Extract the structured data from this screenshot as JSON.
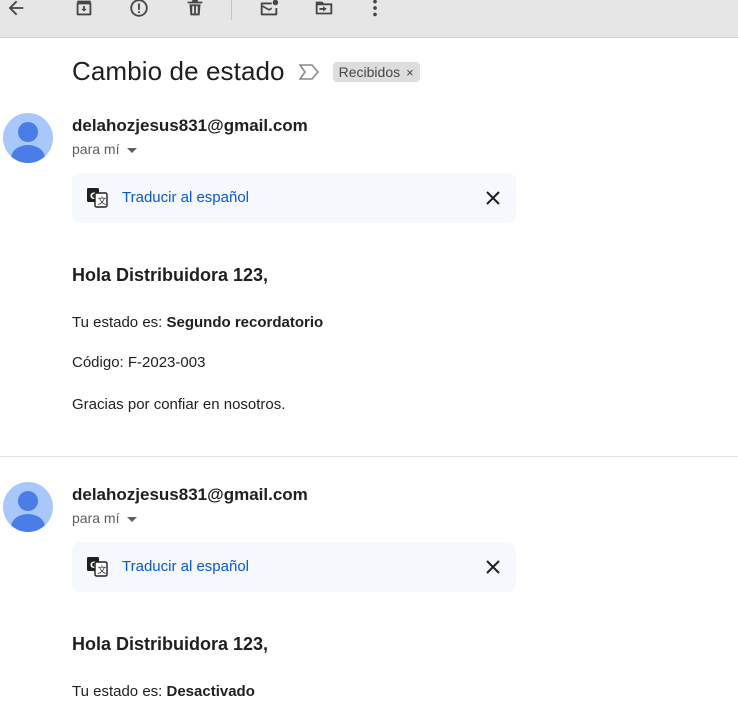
{
  "toolbar": {
    "buttons": [
      {
        "name": "back-arrow-icon"
      },
      {
        "name": "archive-icon"
      },
      {
        "name": "report-spam-icon"
      },
      {
        "name": "delete-icon"
      },
      {
        "name": "mark-unread-icon"
      },
      {
        "name": "move-to-icon"
      },
      {
        "name": "more-vert-icon"
      }
    ]
  },
  "subject": "Cambio de estado",
  "label_chip": {
    "text": "Recibidos",
    "close": "×"
  },
  "messages": [
    {
      "sender": "delahozjesus831@gmail.com",
      "to": "para mí",
      "translate": "Traducir al español",
      "greeting": "Hola Distribuidora 123,",
      "status_prefix": "Tu estado es: ",
      "status_value": "Segundo recordatorio",
      "code": "Código: F-2023-003",
      "thanks": "Gracias por confiar en nosotros."
    },
    {
      "sender": "delahozjesus831@gmail.com",
      "to": "para mí",
      "translate": "Traducir al español",
      "greeting": "Hola Distribuidora 123,",
      "status_prefix": "Tu estado es: ",
      "status_value": "Desactivado"
    }
  ]
}
